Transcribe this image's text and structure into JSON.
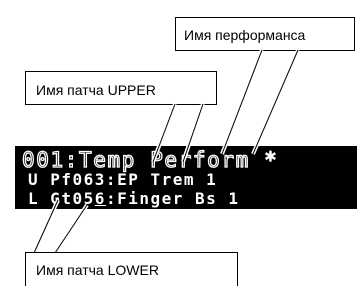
{
  "callouts": {
    "performance_name": "Имя перформанса",
    "upper_patch_name": "Имя патча UPPER",
    "lower_patch_name": "Имя патча LOWER"
  },
  "lcd": {
    "line1": "001:Temp Perform *",
    "line2": "U Pf063:EP Trem 1",
    "line3_prefix": "L Gt05",
    "line3_cursor_char": "6",
    "line3_suffix": ":Finger Bs 1"
  },
  "colors": {
    "display_background": "#000000",
    "display_text": "#ffffff",
    "callout_border": "#000000"
  }
}
